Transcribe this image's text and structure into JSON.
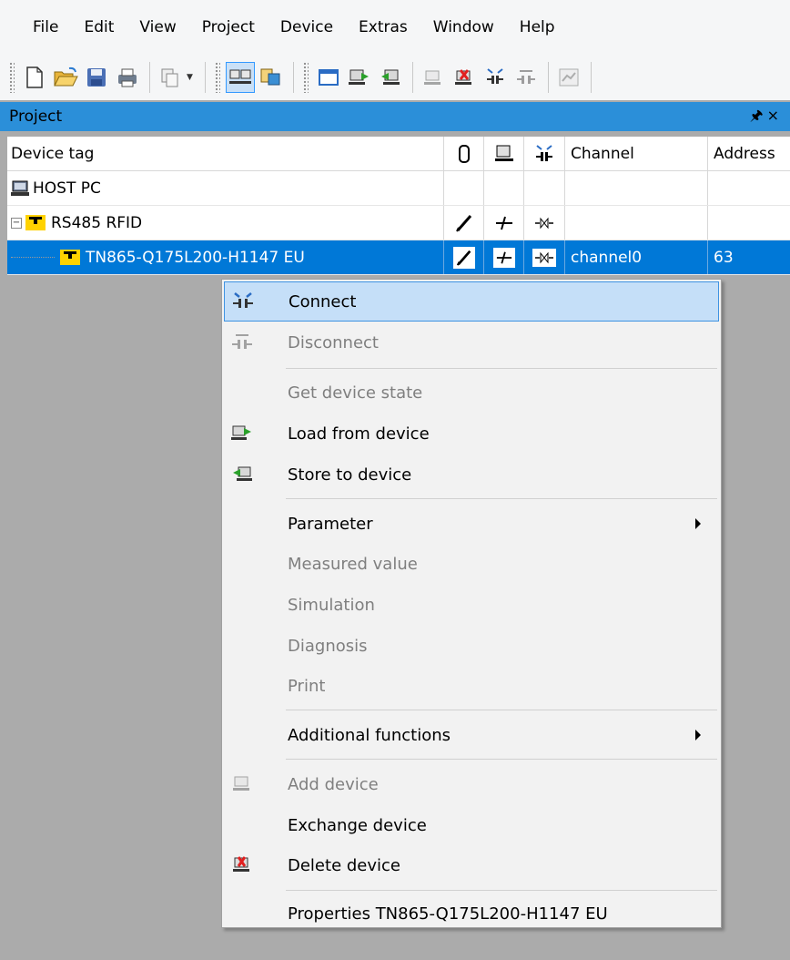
{
  "menubar": {
    "items": [
      "File",
      "Edit",
      "View",
      "Project",
      "Device",
      "Extras",
      "Window",
      "Help"
    ]
  },
  "toolbar": {
    "buttons": [
      "new-icon",
      "open-icon",
      "save-icon",
      "print-icon",
      "copy-icon",
      "project-view-icon",
      "catalog-icon",
      "window-icon",
      "load-icon",
      "store-icon",
      "add-device-icon",
      "delete-device-icon",
      "connect-icon",
      "disconnect-icon",
      "measure-icon"
    ]
  },
  "panel": {
    "title": "Project",
    "pin_glyph": "🖈",
    "close_glyph": "×"
  },
  "grid": {
    "columns": {
      "device_tag": "Device tag",
      "channel": "Channel",
      "address": "Address"
    },
    "rows": [
      {
        "tag": "HOST PC",
        "channel": "",
        "address": ""
      },
      {
        "tag": "RS485 RFID",
        "channel": "",
        "address": ""
      },
      {
        "tag": "TN865-Q175L200-H1147 EU",
        "channel": "channel0",
        "address": "63"
      }
    ]
  },
  "context_menu": {
    "items": [
      {
        "label": "Connect",
        "enabled": true,
        "highlighted": true
      },
      {
        "label": "Disconnect",
        "enabled": false
      },
      {
        "label": "Get device state",
        "enabled": false
      },
      {
        "label": "Load from device",
        "enabled": true
      },
      {
        "label": "Store to device",
        "enabled": true
      },
      {
        "label": "Parameter",
        "enabled": true,
        "submenu": true
      },
      {
        "label": "Measured value",
        "enabled": false
      },
      {
        "label": "Simulation",
        "enabled": false
      },
      {
        "label": "Diagnosis",
        "enabled": false
      },
      {
        "label": "Print",
        "enabled": false
      },
      {
        "label": "Additional functions",
        "enabled": true,
        "submenu": true
      },
      {
        "label": "Add device",
        "enabled": false
      },
      {
        "label": "Exchange device",
        "enabled": true
      },
      {
        "label": "Delete device",
        "enabled": true
      },
      {
        "label": "Properties TN865-Q175L200-H1147 EU",
        "enabled": true
      }
    ]
  },
  "colors": {
    "selection": "#0078d7",
    "panel_title": "#2b8fd9",
    "menu_highlight": "#c5dff8",
    "device_yellow": "#ffd200"
  }
}
